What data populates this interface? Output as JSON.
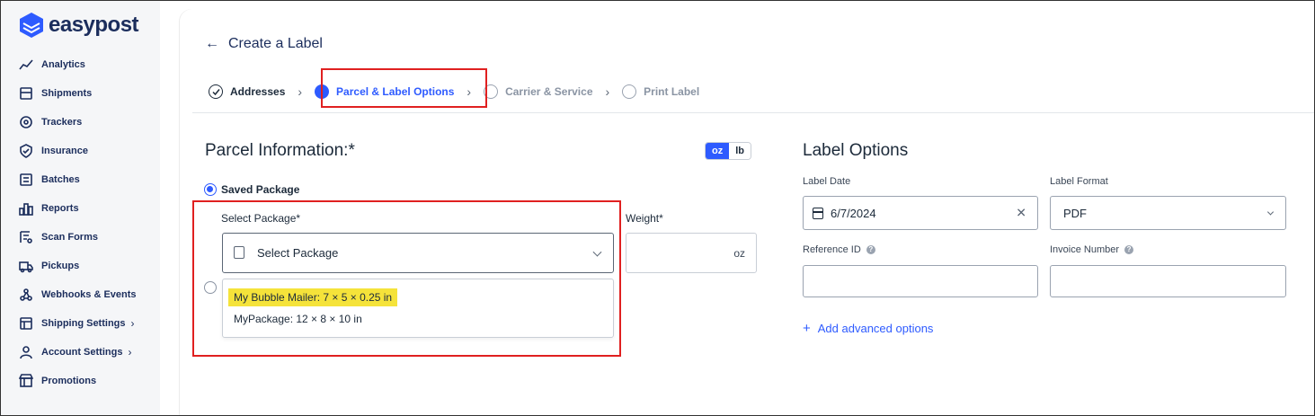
{
  "app": {
    "name": "easypost"
  },
  "sidebar": {
    "items": [
      {
        "label": "Analytics",
        "icon": "chart-line-icon"
      },
      {
        "label": "Shipments",
        "icon": "box-icon"
      },
      {
        "label": "Trackers",
        "icon": "tracker-icon"
      },
      {
        "label": "Insurance",
        "icon": "shield-icon"
      },
      {
        "label": "Batches",
        "icon": "batches-icon"
      },
      {
        "label": "Reports",
        "icon": "reports-icon"
      },
      {
        "label": "Scan Forms",
        "icon": "scan-form-icon"
      },
      {
        "label": "Pickups",
        "icon": "truck-icon"
      },
      {
        "label": "Webhooks & Events",
        "icon": "webhook-icon"
      },
      {
        "label": "Shipping Settings",
        "icon": "shipping-settings-icon",
        "has_chevron": true
      },
      {
        "label": "Account Settings",
        "icon": "account-settings-icon",
        "has_chevron": true
      },
      {
        "label": "Promotions",
        "icon": "store-icon"
      }
    ]
  },
  "header": {
    "title": "Create a Label"
  },
  "stepper": {
    "steps": [
      {
        "label": "Addresses",
        "state": "done"
      },
      {
        "label": "Parcel & Label Options",
        "state": "active"
      },
      {
        "label": "Carrier & Service",
        "state": "future"
      },
      {
        "label": "Print Label",
        "state": "future"
      }
    ]
  },
  "parcel": {
    "title": "Parcel Information:*",
    "units": {
      "oz": "oz",
      "lb": "lb",
      "selected": "oz"
    },
    "saved_package_label": "Saved Package",
    "select_package_label": "Select Package*",
    "select_package_value": "Select Package",
    "weight_label": "Weight*",
    "weight_unit": "oz",
    "dropdown_options": [
      "My Bubble Mailer: 7 × 5 × 0.25 in",
      "MyPackage: 12 × 8 × 10 in"
    ]
  },
  "label_options": {
    "title": "Label Options",
    "label_date_label": "Label Date",
    "label_date_value": "6/7/2024",
    "label_format_label": "Label Format",
    "label_format_value": "PDF",
    "reference_id_label": "Reference ID",
    "invoice_number_label": "Invoice Number",
    "add_advanced": "Add advanced options"
  },
  "colors": {
    "accent": "#2e5bff",
    "highlight": "#f5e33a",
    "annotation": "#e02020",
    "brand": "#1b2d5c"
  }
}
